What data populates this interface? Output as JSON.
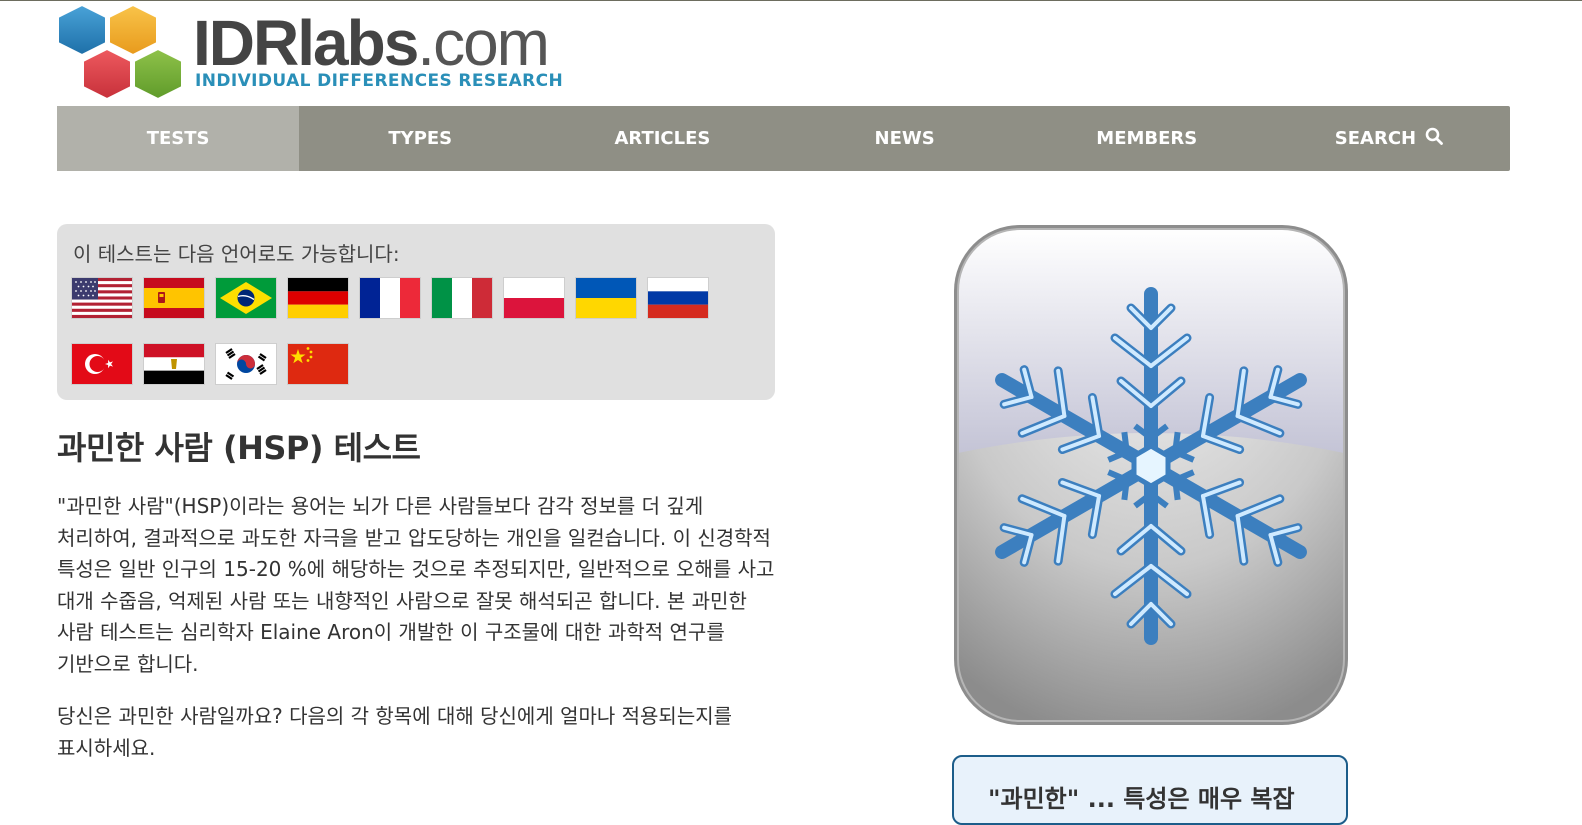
{
  "header": {
    "brand_main": "IDRlabs",
    "brand_suffix": ".com",
    "tagline": "INDIVIDUAL DIFFERENCES RESEARCH",
    "logo_icon": "hexagon-cluster-logo"
  },
  "nav": {
    "items": [
      {
        "label": "TESTS",
        "active": true
      },
      {
        "label": "TYPES",
        "active": false
      },
      {
        "label": "ARTICLES",
        "active": false
      },
      {
        "label": "NEWS",
        "active": false
      },
      {
        "label": "MEMBERS",
        "active": false
      },
      {
        "label": "SEARCH",
        "active": false,
        "icon": "search-icon"
      }
    ],
    "colors": {
      "bar": "#8f8f85",
      "active": "#b1b1aa",
      "text": "#ffffff"
    }
  },
  "languages": {
    "label": "이 테스트는 다음 언어로도 가능합니다:",
    "flags": [
      "united-states",
      "spain",
      "brazil",
      "germany",
      "france",
      "italy",
      "poland",
      "ukraine",
      "russia",
      "turkey",
      "egypt",
      "south-korea",
      "china"
    ]
  },
  "main": {
    "title": "과민한 사람 (HSP) 테스트",
    "intro": "\"과민한 사람\"(HSP)이라는 용어는 뇌가 다른 사람들보다 감각 정보를 더 깊게 처리하여, 결과적으로 과도한 자극을 받고 압도당하는 개인을 일컫습니다. 이 신경학적 특성은 일반 인구의 15-20 %에 해당하는 것으로 추정되지만, 일반적으로 오해를 사고 대개 수줍음, 억제된 사람 또는 내향적인 사람으로 잘못 해석되곤 합니다. 본 과민한 사람 테스트는 심리학자 Elaine Aron이 개발한 이 구조물에 대한 과학적 연구를 기반으로 합니다.",
    "prompt": "당신은 과민한 사람일까요? 다음의 각 항목에 대해 당신에게 얼마나 적용되는지를 표시하세요."
  },
  "sidebar": {
    "image_icon": "snowflake-icon",
    "infobox_text": "\"과민한\" ... 특성은 매우 복잡",
    "colors": {
      "infobox_border": "#1c5d8a",
      "infobox_bg": "#e8f2fb"
    }
  }
}
